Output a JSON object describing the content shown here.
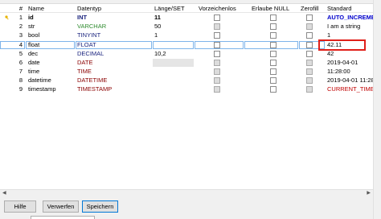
{
  "headers": {
    "num": "#",
    "name": "Name",
    "type": "Datentyp",
    "length": "Länge/SET",
    "unsigned": "Vorzeichenlos",
    "allow_null": "Erlaube NULL",
    "zerofill": "Zerofill",
    "default": "Standard"
  },
  "rows": [
    {
      "num": "1",
      "name": "id",
      "type": "INT",
      "length": "11",
      "default": "AUTO_INCREME..."
    },
    {
      "num": "2",
      "name": "str",
      "type": "VARCHAR",
      "length": "50",
      "default": "I am a string"
    },
    {
      "num": "3",
      "name": "bool",
      "type": "TINYINT",
      "length": "1",
      "default": "1"
    },
    {
      "num": "4",
      "name": "float",
      "type": "FLOAT",
      "length": "",
      "default": "42.11"
    },
    {
      "num": "5",
      "name": "dec",
      "type": "DECIMAL",
      "length": "10,2",
      "default": "42"
    },
    {
      "num": "6",
      "name": "date",
      "type": "DATE",
      "length": "",
      "default": "2019-04-01"
    },
    {
      "num": "7",
      "name": "time",
      "type": "TIME",
      "length": "",
      "default": "11:28:00"
    },
    {
      "num": "8",
      "name": "datetime",
      "type": "DATETIME",
      "length": "",
      "default": "2019-04-01 11:28:00"
    },
    {
      "num": "9",
      "name": "timestamp",
      "type": "TIMESTAMP",
      "length": "",
      "default": "CURRENT_TIMES..."
    }
  ],
  "buttons": {
    "help": "Hilfe",
    "discard": "Verwerfen",
    "save": "Speichern"
  },
  "colors": {
    "int_type": "#1a237e",
    "string_type": "#2e8b2e",
    "temporal_type": "#8b0000",
    "auto_increment": "#0000cc",
    "current_timestamp": "#c00000",
    "annotation_box": "#e0201a"
  },
  "icons": {
    "primary_key": "key-icon",
    "scroll_left": "arrow-left-icon",
    "scroll_right": "arrow-right-icon"
  }
}
